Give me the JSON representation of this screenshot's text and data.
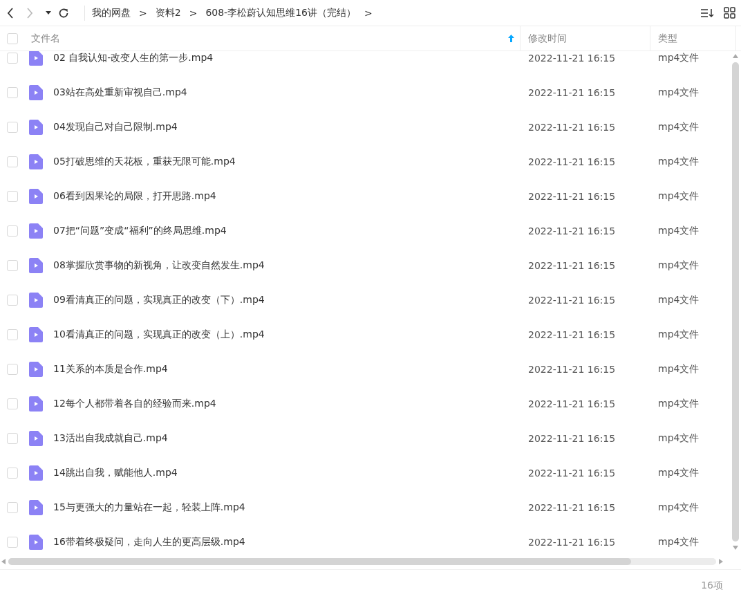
{
  "toolbar": {
    "breadcrumbs": [
      "我的网盘",
      "资料2",
      "608-李松蔚认知思维16讲（完结）"
    ],
    "separator": ">"
  },
  "table": {
    "select_all": {
      "checked": false
    },
    "columns": [
      {
        "label": "文件名",
        "sorted": true
      },
      {
        "label": "修改时间",
        "sorted": false
      },
      {
        "label": "类型",
        "sorted": false
      }
    ],
    "rows": [
      {
        "name": "02 自我认知-改变人生的第一步.mp4",
        "modified": "2022-11-21 16:15",
        "type": "mp4文件",
        "checked": false
      },
      {
        "name": "03站在高处重新审视自己.mp4",
        "modified": "2022-11-21 16:15",
        "type": "mp4文件",
        "checked": false
      },
      {
        "name": "04发现自己对自己限制.mp4",
        "modified": "2022-11-21 16:15",
        "type": "mp4文件",
        "checked": false
      },
      {
        "name": "05打破思维的天花板，重获无限可能.mp4",
        "modified": "2022-11-21 16:15",
        "type": "mp4文件",
        "checked": false
      },
      {
        "name": "06看到因果论的局限，打开思路.mp4",
        "modified": "2022-11-21 16:15",
        "type": "mp4文件",
        "checked": false
      },
      {
        "name": "07把“问题”变成“福利”的终局思维.mp4",
        "modified": "2022-11-21 16:15",
        "type": "mp4文件",
        "checked": false
      },
      {
        "name": "08掌握欣赏事物的新视角，让改变自然发生.mp4",
        "modified": "2022-11-21 16:15",
        "type": "mp4文件",
        "checked": false
      },
      {
        "name": "09看清真正的问题，实现真正的改变（下）.mp4",
        "modified": "2022-11-21 16:15",
        "type": "mp4文件",
        "checked": false
      },
      {
        "name": "10看清真正的问题，实现真正的改变（上）.mp4",
        "modified": "2022-11-21 16:15",
        "type": "mp4文件",
        "checked": false
      },
      {
        "name": "11关系的本质是合作.mp4",
        "modified": "2022-11-21 16:15",
        "type": "mp4文件",
        "checked": false
      },
      {
        "name": "12每个人都带着各自的经验而来.mp4",
        "modified": "2022-11-21 16:15",
        "type": "mp4文件",
        "checked": false
      },
      {
        "name": "13活出自我成就自己.mp4",
        "modified": "2022-11-21 16:15",
        "type": "mp4文件",
        "checked": false
      },
      {
        "name": "14跳出自我，赋能他人.mp4",
        "modified": "2022-11-21 16:15",
        "type": "mp4文件",
        "checked": false
      },
      {
        "name": "15与更强大的力量站在一起，轻装上阵.mp4",
        "modified": "2022-11-21 16:15",
        "type": "mp4文件",
        "checked": false
      },
      {
        "name": "16带着终极疑问，走向人生的更高层级.mp4",
        "modified": "2022-11-21 16:15",
        "type": "mp4文件",
        "checked": false
      }
    ]
  },
  "status_bar": {
    "count": "16项"
  }
}
